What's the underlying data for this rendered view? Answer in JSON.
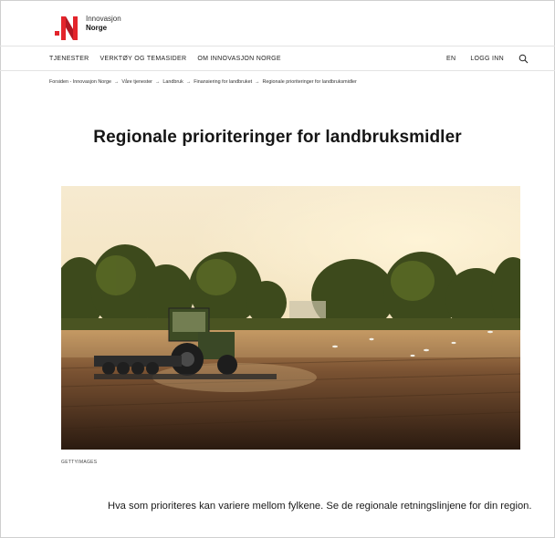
{
  "brand": {
    "name_line1": "Innovasjon",
    "name_line2": "Norge",
    "accent_red": "#e3242b",
    "accent_dark_red": "#8b0f1e"
  },
  "nav": {
    "left": [
      "TJENESTER",
      "VERKTØY OG TEMASIDER",
      "OM INNOVASJON NORGE"
    ],
    "right": [
      "EN",
      "LOGG INN"
    ],
    "search_icon": "search-icon"
  },
  "breadcrumb": {
    "items": [
      "Forsiden - Innovasjon Norge",
      "Våre tjenester",
      "Landbruk",
      "Finansiering for landbruket",
      "Regionale prioriteringer for landbruksmidler"
    ],
    "separator": "→"
  },
  "page": {
    "title": "Regionale prioriteringer for landbruksmidler",
    "image_caption": "GETTYIMAGES",
    "intro": "Hva som prioriteres kan variere mellom fylkene. Se de regionale retningslinjene for din region."
  }
}
